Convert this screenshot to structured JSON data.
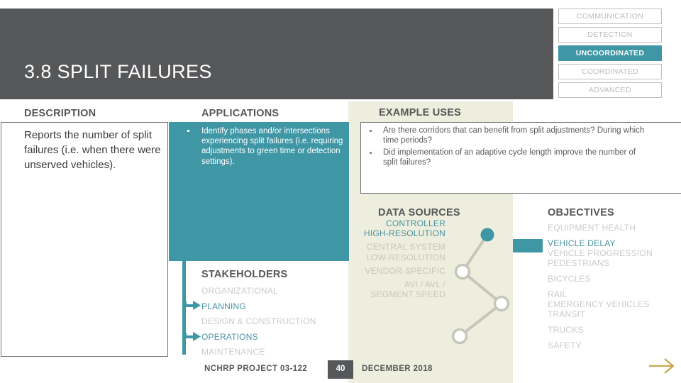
{
  "header": {
    "title": "3.8 SPLIT FAILURES"
  },
  "tags": [
    {
      "label": "COMMUNICATION",
      "active": false
    },
    {
      "label": "DETECTION",
      "active": false
    },
    {
      "label": "UNCOORDINATED",
      "active": true
    },
    {
      "label": "COORDINATED",
      "active": false
    },
    {
      "label": "ADVANCED",
      "active": false
    }
  ],
  "sections": {
    "description_heading": "DESCRIPTION",
    "applications_heading": "APPLICATIONS",
    "example_uses_heading": "EXAMPLE USES",
    "data_sources_heading": "DATA SOURCES",
    "objectives_heading": "OBJECTIVES",
    "stakeholders_heading": "STAKEHOLDERS"
  },
  "description": {
    "text": "Reports the number of split failures (i.e. when there were unserved vehicles)."
  },
  "applications": {
    "items": [
      "Identify phases and/or intersections experiencing split failures (i.e. requiring adjustments to green time or detection settings)."
    ]
  },
  "example_uses": {
    "items": [
      "Are there corridors that can benefit from split adjustments? During which time periods?",
      "Did implementation of an adaptive cycle length improve the number of split failures?"
    ]
  },
  "stakeholders": {
    "items": [
      {
        "label": "ORGANIZATIONAL",
        "active": false
      },
      {
        "label": "PLANNING",
        "active": true
      },
      {
        "label": "DESIGN & CONSTRUCTION",
        "active": false
      },
      {
        "label": "OPERATIONS",
        "active": true
      },
      {
        "label": "MAINTENANCE",
        "active": false
      }
    ]
  },
  "data_sources": {
    "items": [
      {
        "label": "CONTROLLER HIGH-RESOLUTION",
        "active": true
      },
      {
        "label": "CENTRAL SYSTEM LOW-RESOLUTION",
        "active": false
      },
      {
        "label": "VENDOR-SPECIFIC",
        "active": false
      },
      {
        "label": "AVI / AVL / SEGMENT SPEED",
        "active": false
      }
    ]
  },
  "objectives": {
    "items": [
      {
        "label": "EQUIPMENT HEALTH",
        "active": false
      },
      {
        "label": "VEHICLE DELAY",
        "active": true
      },
      {
        "label": "VEHICLE PROGRESSION",
        "active": false
      },
      {
        "label": "PEDESTRIANS",
        "active": false
      },
      {
        "label": "BICYCLES",
        "active": false
      },
      {
        "label": "RAIL",
        "active": false
      },
      {
        "label": "EMERGENCY VEHICLES",
        "active": false
      },
      {
        "label": "TRANSIT",
        "active": false
      },
      {
        "label": "TRUCKS",
        "active": false
      },
      {
        "label": "SAFETY",
        "active": false
      }
    ]
  },
  "footer": {
    "project": "NCHRP PROJECT 03-122",
    "page": "40",
    "date": "DECEMBER 2018"
  },
  "colors": {
    "teal": "#3f97a6",
    "dark_gray": "#565759",
    "cream": "#edeedd",
    "muted": "#c9cbcb",
    "gold": "#c9a84c"
  }
}
